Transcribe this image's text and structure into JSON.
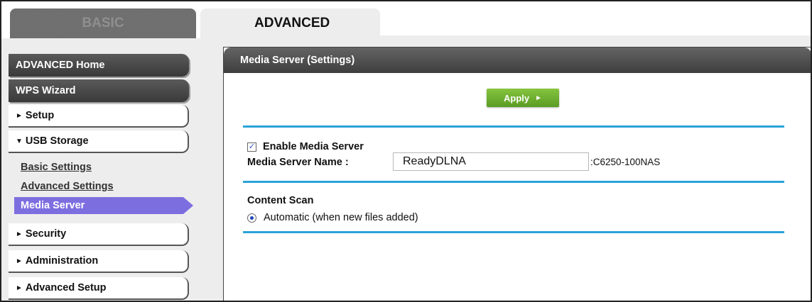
{
  "tabs": {
    "basic_label": "BASIC",
    "advanced_label": "ADVANCED"
  },
  "sidebar": {
    "advanced_home": "ADVANCED Home",
    "wps_wizard": "WPS Wizard",
    "setup": "Setup",
    "usb_storage": "USB Storage",
    "usb_sub": {
      "basic_settings": "Basic Settings",
      "advanced_settings": "Advanced Settings",
      "media_server": "Media Server"
    },
    "security": "Security",
    "administration": "Administration",
    "advanced_setup": "Advanced Setup"
  },
  "panel": {
    "title": "Media Server (Settings)",
    "apply_label": "Apply",
    "enable_label": "Enable Media Server",
    "enable_checked": true,
    "name_label": "Media Server Name :",
    "name_value": "ReadyDLNA",
    "name_suffix": ":C6250-100NAS",
    "content_scan_label": "Content Scan",
    "auto_label": "Automatic (when new files added)"
  },
  "colors": {
    "accent_blue": "#2aa3d8",
    "active_purple": "#7d6ee0",
    "apply_green": "#6fb032"
  }
}
